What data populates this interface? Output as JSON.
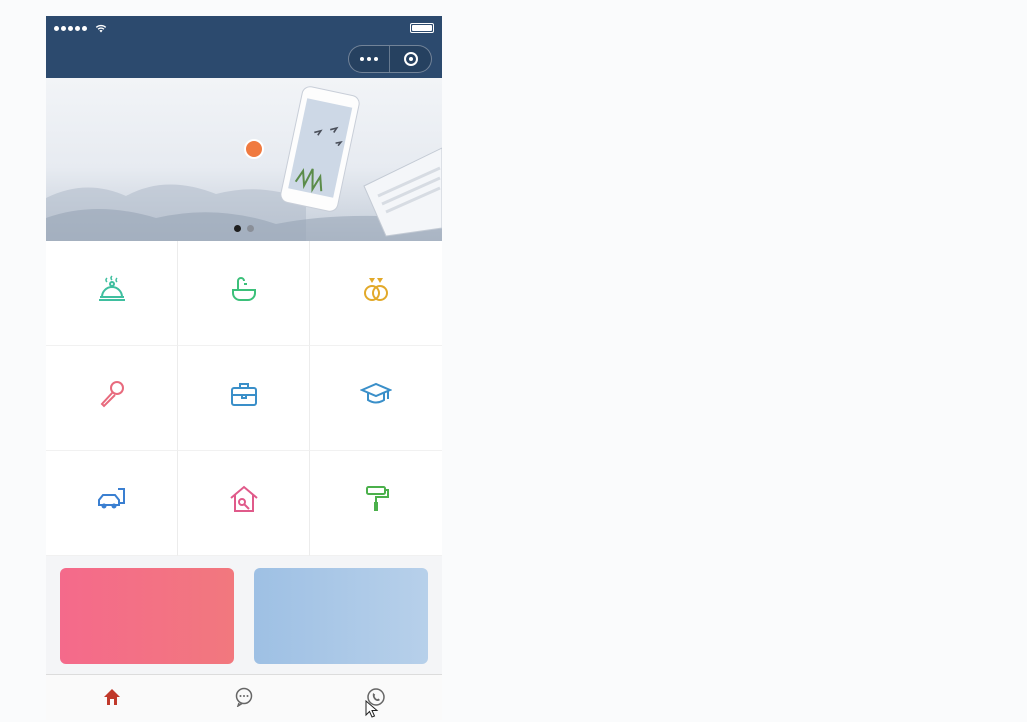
{
  "colors": {
    "nav_bg": "#2c4a6e",
    "accent_red": "#a00000",
    "tab_active": "#c0392b",
    "card_shop": "#f46a8b",
    "card_forum": "#9ec0e4",
    "slide_dot_active": "#1e1e1e",
    "slide_dot_inactive": "#8a8f98"
  },
  "phone": {
    "status": {
      "carrier": "",
      "time": "",
      "battery": ""
    },
    "navbar": {
      "title": "",
      "more_icon": "more-icon",
      "close_icon": "capsule-close-icon"
    },
    "banner": {
      "title": "",
      "subtitle": "",
      "slogan": "",
      "desc_line1": "",
      "desc_line2": "",
      "slide_count": 2,
      "active_slide": 1
    },
    "grid": [
      {
        "label": "",
        "icon": "food-tray-icon",
        "color": "#3fbf9f"
      },
      {
        "label": "",
        "icon": "bath-icon",
        "color": "#3cc07a"
      },
      {
        "label": "",
        "icon": "wedding-rings-icon",
        "color": "#e2a92a"
      },
      {
        "label": "",
        "icon": "microphone-icon",
        "color": "#e86a7d"
      },
      {
        "label": "",
        "icon": "briefcase-icon",
        "color": "#3a8fc9"
      },
      {
        "label": "",
        "icon": "graduation-cap-icon",
        "color": "#3a8fc9"
      },
      {
        "label": "",
        "icon": "car-wash-icon",
        "color": "#3a7fd1"
      },
      {
        "label": "",
        "icon": "house-icon",
        "color": "#e05a8a"
      },
      {
        "label": "",
        "icon": "paint-roller-icon",
        "color": "#4bb04b"
      }
    ],
    "cards": [
      {
        "label": ""
      },
      {
        "label": ""
      }
    ],
    "tabbar": [
      {
        "label": "",
        "icon": "home-icon",
        "active": true
      },
      {
        "label": "",
        "icon": "message-icon",
        "active": false
      },
      {
        "label": "",
        "icon": "phone-icon",
        "active": false
      }
    ]
  },
  "checklist": [
    {
      "num": "",
      "text_before": "",
      "highlight": "",
      "text_after": ""
    },
    {
      "num": "",
      "text_before": "",
      "highlight": "",
      "text_after": ""
    },
    {
      "num": "",
      "text_before": "",
      "highlight": "",
      "text_after": ""
    },
    {
      "num": "",
      "text_before": "",
      "highlight": "",
      "text_after": ""
    },
    {
      "num": "",
      "text_before": "",
      "highlight": "",
      "text_after": ""
    },
    {
      "num": "",
      "text_before": "",
      "highlight": "",
      "text_after": ""
    }
  ]
}
